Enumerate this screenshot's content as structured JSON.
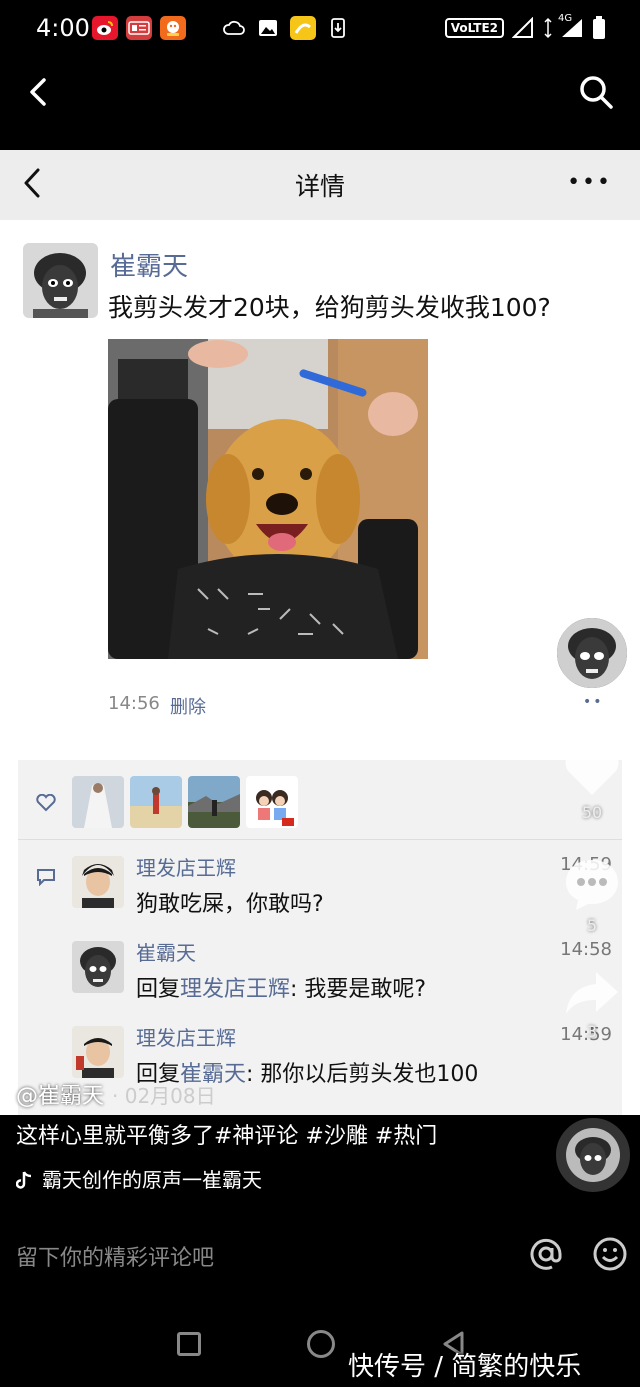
{
  "status_bar": {
    "time": "4:00",
    "app_icons": [
      {
        "name": "weibo-icon",
        "color": "#e6162d",
        "glyph": "微"
      },
      {
        "name": "toutiao-icon",
        "color": "#d43d3d",
        "glyph": "头条"
      },
      {
        "name": "game-app-icon",
        "color": "#f26b1d",
        "glyph": "玩"
      }
    ],
    "network_label": "VoLTE2",
    "signal_label": "4G"
  },
  "app_bar": {
    "back_icon": "chevron-left-icon",
    "search_icon": "search-icon"
  },
  "wechat_screenshot": {
    "header_title": "详情",
    "more_label": "•••",
    "post": {
      "author": "崔霸天",
      "text": "我剪头发才20块，给狗剪头发收我100?",
      "time": "14:56",
      "delete_label": "删除",
      "dots_label": "••"
    },
    "likes_count": 4,
    "comments": [
      {
        "name": "理发店王辉",
        "time": "14:59",
        "text": "狗敢吃屎，你敢吗?"
      },
      {
        "name": "崔霸天",
        "time": "14:58",
        "prefix": "回复",
        "reply_to": "理发店王辉",
        "text": ": 我要是敢呢?"
      },
      {
        "name": "理发店王辉",
        "time": "14:59",
        "prefix": "回复",
        "reply_to": "崔霸天",
        "text": ": 那你以后剪头发也100"
      }
    ]
  },
  "video_overlay": {
    "like_count": "50",
    "comment_count": "5",
    "share_count": "3",
    "author_handle": "@崔霸天",
    "date": "· 02月08日",
    "caption": "这样心里就平衡多了#神评论 #沙雕 #热门",
    "music": "霸天创作的原声一崔霸天",
    "comment_placeholder": "留下你的精彩评论吧"
  },
  "watermark": "快传号 / 简繁的快乐",
  "colors": {
    "link_blue": "#576b95",
    "header_gray": "#ededed",
    "comment_bg": "#f2f2f2"
  }
}
